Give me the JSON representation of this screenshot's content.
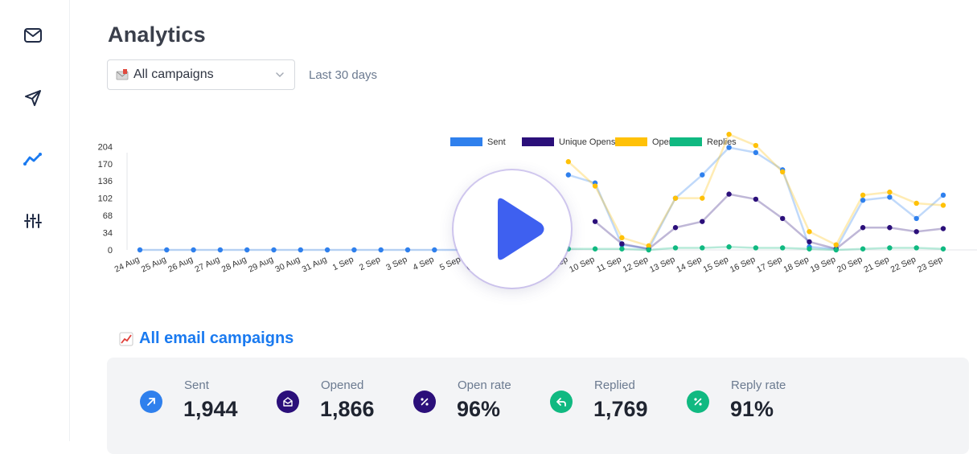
{
  "sidebar": {
    "items": [
      {
        "name": "inbox",
        "icon": "mail-icon",
        "active": false
      },
      {
        "name": "campaigns",
        "icon": "send-icon",
        "active": false
      },
      {
        "name": "analytics",
        "icon": "trend-icon",
        "active": true
      },
      {
        "name": "settings",
        "icon": "sliders-icon",
        "active": false
      }
    ]
  },
  "header": {
    "title": "Analytics",
    "campaign_select": {
      "value": "All campaigns",
      "icon": "envelope-icon"
    },
    "range_label": "Last 30 days"
  },
  "chart_data": {
    "type": "line",
    "categories": [
      "24 Aug",
      "25 Aug",
      "26 Aug",
      "27 Aug",
      "28 Aug",
      "29 Aug",
      "30 Aug",
      "31 Aug",
      "1 Sep",
      "2 Sep",
      "3 Sep",
      "4 Sep",
      "5 Sep",
      "6 Sep",
      "7 Sep",
      "8 Sep",
      "9 Sep",
      "10 Sep",
      "11 Sep",
      "12 Sep",
      "13 Sep",
      "14 Sep",
      "15 Sep",
      "16 Sep",
      "17 Sep",
      "18 Sep",
      "19 Sep",
      "20 Sep",
      "21 Sep",
      "22 Sep",
      "23 Sep"
    ],
    "y_ticks": [
      0,
      34,
      68,
      102,
      136,
      170,
      204
    ],
    "ylim": [
      0,
      214
    ],
    "series": [
      {
        "name": "Sent",
        "color": "#2f80ed",
        "values": [
          0,
          0,
          0,
          0,
          0,
          0,
          0,
          0,
          0,
          0,
          0,
          0,
          0,
          null,
          null,
          null,
          148,
          132,
          10,
          2,
          102,
          148,
          202,
          192,
          158,
          6,
          2,
          98,
          104,
          62,
          108
        ]
      },
      {
        "name": "Unique Opens",
        "color": "#2b0f7a",
        "values": [
          null,
          null,
          null,
          null,
          null,
          null,
          null,
          null,
          null,
          null,
          null,
          null,
          null,
          null,
          null,
          70,
          null,
          56,
          12,
          2,
          44,
          56,
          110,
          100,
          62,
          16,
          2,
          44,
          44,
          36,
          42
        ]
      },
      {
        "name": "Opens",
        "color": "#ffc107",
        "values": [
          null,
          null,
          null,
          null,
          null,
          null,
          null,
          null,
          null,
          null,
          null,
          null,
          null,
          null,
          null,
          null,
          174,
          126,
          24,
          8,
          102,
          102,
          228,
          206,
          154,
          36,
          10,
          108,
          114,
          92,
          88
        ]
      },
      {
        "name": "Replies",
        "color": "#10b981",
        "values": [
          null,
          null,
          null,
          null,
          null,
          null,
          null,
          null,
          null,
          null,
          null,
          null,
          null,
          null,
          null,
          null,
          2,
          2,
          2,
          0,
          4,
          4,
          6,
          4,
          4,
          2,
          0,
          2,
          4,
          4,
          2
        ]
      }
    ]
  },
  "section": {
    "title": "All email campaigns",
    "icon": "chart-emoji-icon"
  },
  "stats": [
    {
      "label": "Sent",
      "value": "1,944",
      "color": "#2f80ed",
      "icon": "send-arrow-icon"
    },
    {
      "label": "Opened",
      "value": "1,866",
      "color": "#2b0f7a",
      "icon": "open-envelope-icon"
    },
    {
      "label": "Open rate",
      "value": "96%",
      "color": "#2b0f7a",
      "icon": "percent-icon"
    },
    {
      "label": "Replied",
      "value": "1,769",
      "color": "#10b981",
      "icon": "reply-icon"
    },
    {
      "label": "Reply rate",
      "value": "91%",
      "color": "#10b981",
      "icon": "percent-icon"
    }
  ]
}
